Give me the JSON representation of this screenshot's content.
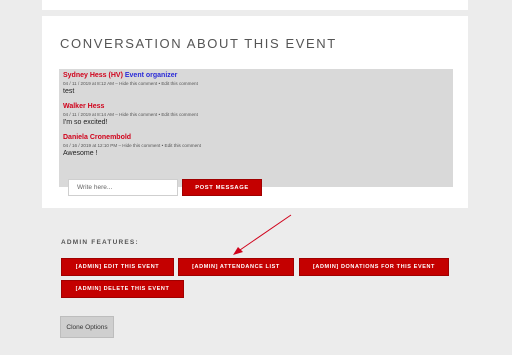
{
  "conversation": {
    "title": "CONVERSATION ABOUT THIS EVENT",
    "comments": [
      {
        "author": "Sydney Hess (HV)",
        "role": "Event organizer",
        "meta": "04 / 11 / 2019 at 8:12 AM",
        "hide_label": "Hide this comment",
        "edit_label": "Edit this comment",
        "text": "test"
      },
      {
        "author": "Walker Hess",
        "role": "",
        "meta": "04 / 11 / 2019 at 8:14 AM",
        "hide_label": "Hide this comment",
        "edit_label": "Edit this comment",
        "text": "I'm so excited!"
      },
      {
        "author": "Daniela Cronembold",
        "role": "",
        "meta": "04 / 16 / 2019 at 12:10 PM",
        "hide_label": "Hide this comment",
        "edit_label": "Edit this comment",
        "text": "Awesome !"
      }
    ],
    "input_placeholder": "Write here...",
    "input_value": "",
    "post_button": "POST MESSAGE"
  },
  "admin": {
    "label": "ADMIN FEATURES:",
    "edit_button": "[ADMIN] EDIT THIS EVENT",
    "attendance_button": "[ADMIN] ATTENDANCE LIST",
    "donations_button": "[ADMIN] DONATIONS FOR THIS EVENT",
    "delete_button": "[ADMIN] DELETE THIS EVENT"
  },
  "clone_button": "Clone Options",
  "colors": {
    "accent": "#c40000",
    "author": "#d0021b",
    "role": "#2b2bd8",
    "background": "#ececec"
  }
}
